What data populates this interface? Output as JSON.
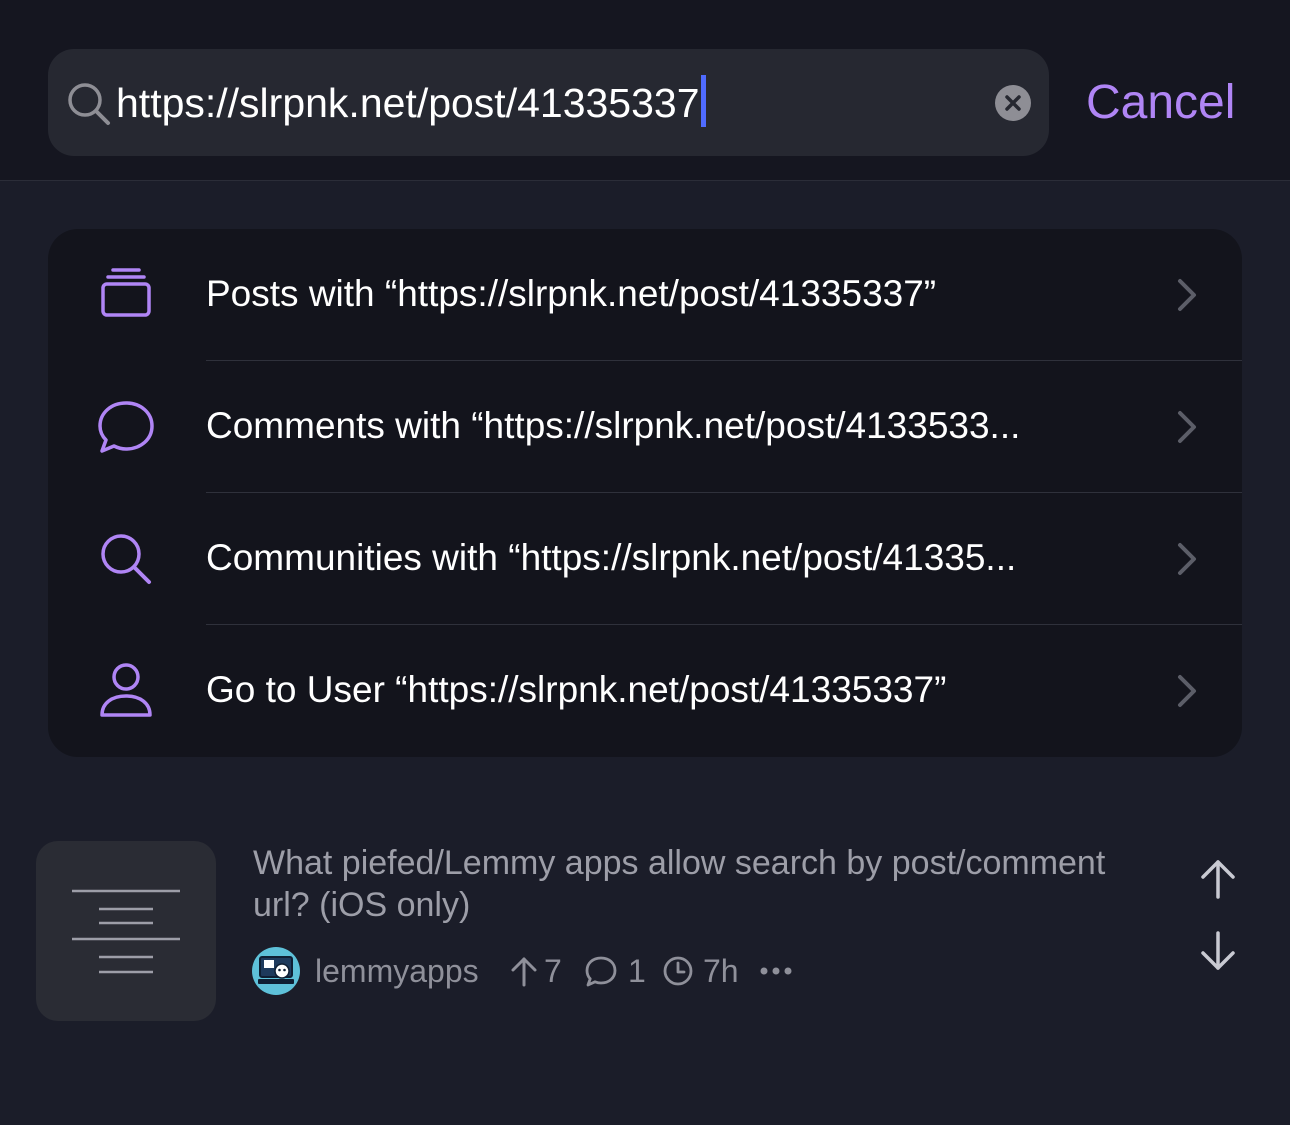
{
  "search": {
    "query": "https://slrpnk.net/post/41335337",
    "cancel_label": "Cancel"
  },
  "options": [
    {
      "label": "Posts with “https://slrpnk.net/post/41335337”",
      "icon": "stack-icon"
    },
    {
      "label": "Comments with “https://slrpnk.net/post/4133533...",
      "icon": "comment-bubble-icon"
    },
    {
      "label": "Communities with “https://slrpnk.net/post/41335...",
      "icon": "magnifier-icon"
    },
    {
      "label": "Go to User “https://slrpnk.net/post/41335337”",
      "icon": "person-icon"
    }
  ],
  "result": {
    "title": "What piefed/Lemmy apps allow search by post/comment url? (iOS only)",
    "community": "lemmyapps",
    "upvotes": "7",
    "comments": "1",
    "age": "7h"
  },
  "colors": {
    "accent": "#b085f5",
    "background": "#1b1d29",
    "card": "#13141c"
  }
}
